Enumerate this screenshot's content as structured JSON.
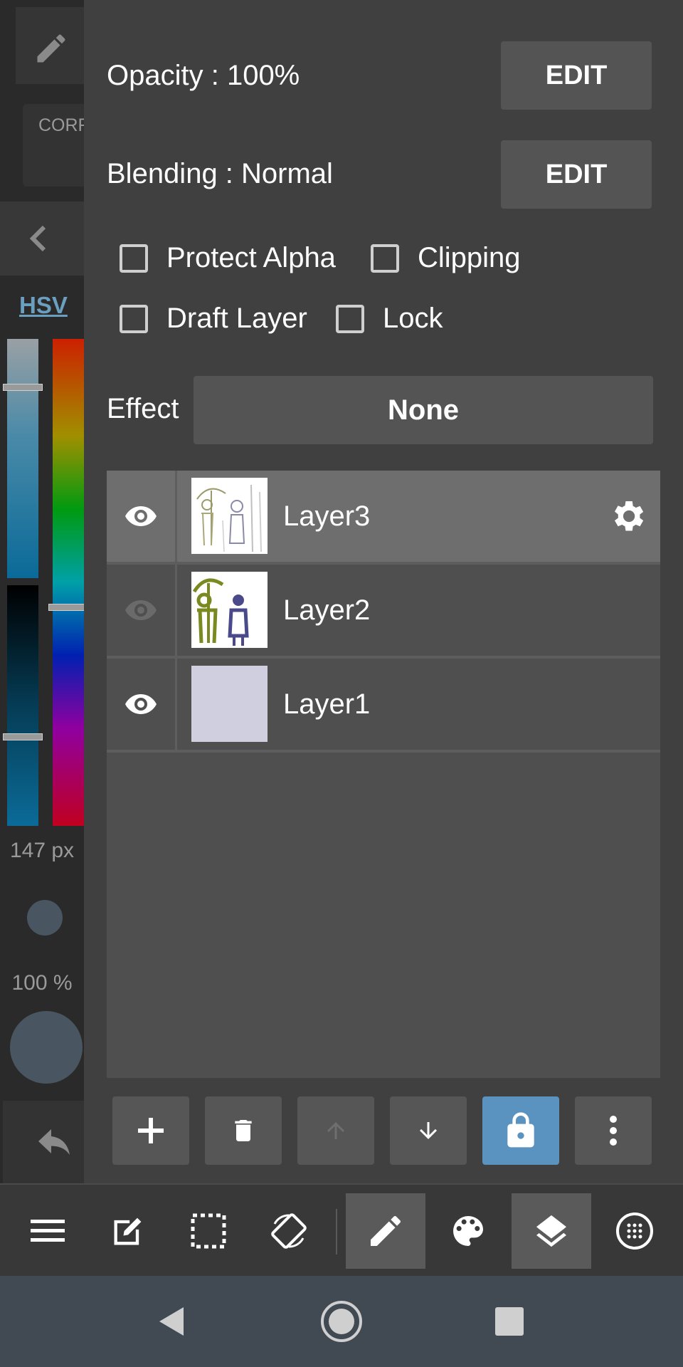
{
  "sidebar": {
    "corr_text": "CORR",
    "color_mode": "HSV",
    "brush_size": "147 px",
    "brush_opacity": "100 %"
  },
  "properties": {
    "opacity_label": "Opacity : 100%",
    "opacity_edit": "EDIT",
    "blending_label": "Blending : Normal",
    "blending_edit": "EDIT",
    "protect_alpha": "Protect Alpha",
    "clipping": "Clipping",
    "draft_layer": "Draft Layer",
    "lock": "Lock",
    "effect_label": "Effect",
    "effect_value": "None"
  },
  "layers": [
    {
      "name": "Layer3",
      "visible": true,
      "selected": true
    },
    {
      "name": "Layer2",
      "visible": false,
      "selected": false
    },
    {
      "name": "Layer1",
      "visible": true,
      "selected": false
    }
  ],
  "layer_tools": [
    "add-layer",
    "delete-layer",
    "move-layer-up",
    "move-layer-down",
    "lock-layer",
    "more-options"
  ],
  "bottom_tools": [
    "menu",
    "edit",
    "selection",
    "rotate-canvas",
    "pencil",
    "palette",
    "layers",
    "grid"
  ],
  "colors": {
    "panel_bg": "#404040",
    "selected_row": "#6e6e6e",
    "active_accent": "#5a93c0",
    "nav_bar": "#414952"
  }
}
